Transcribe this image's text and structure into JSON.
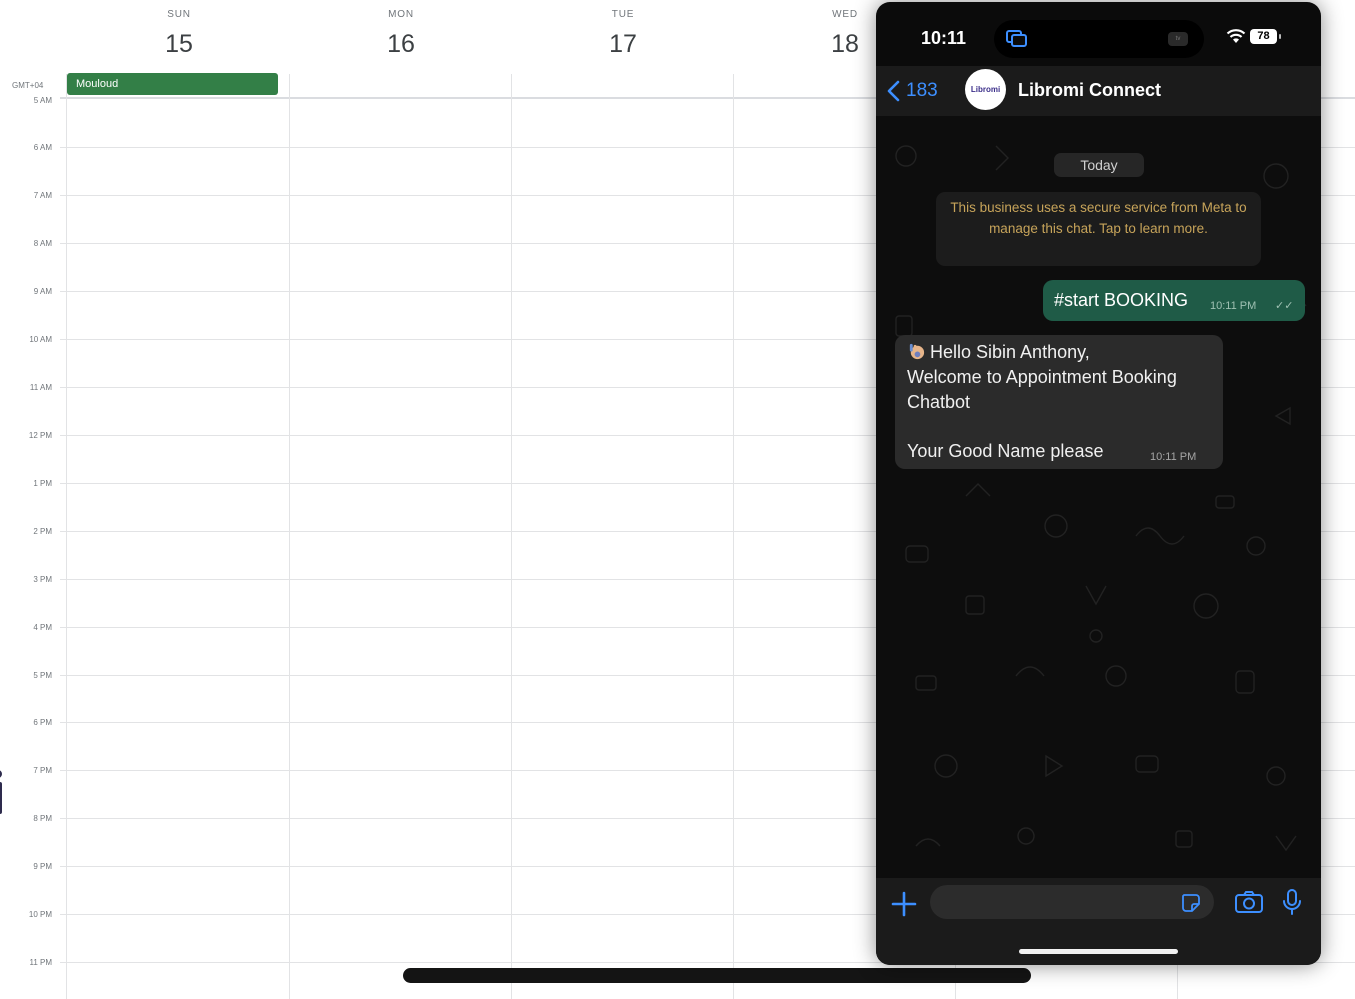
{
  "calendar": {
    "days": [
      {
        "name": "SUN",
        "num": "15"
      },
      {
        "name": "MON",
        "num": "16"
      },
      {
        "name": "TUE",
        "num": "17"
      },
      {
        "name": "WED",
        "num": "18"
      }
    ],
    "timezone": "GMT+04",
    "hours": [
      "5 AM",
      "6 AM",
      "7 AM",
      "8 AM",
      "9 AM",
      "10 AM",
      "11 AM",
      "12 PM",
      "1 PM",
      "2 PM",
      "3 PM",
      "4 PM",
      "5 PM",
      "6 PM",
      "7 PM",
      "8 PM",
      "9 PM",
      "10 PM",
      "11 PM"
    ],
    "event": {
      "title": "Mouloud",
      "color": "#337f47"
    }
  },
  "phone": {
    "status": {
      "time": "10:11",
      "battery": "78",
      "island_badge": "tv"
    },
    "header": {
      "back_count": "183",
      "title": "Libromi Connect",
      "avatar_text": "Libromi"
    },
    "chat": {
      "date_pill": "Today",
      "notice": "This business uses a secure service from Meta to manage this chat. Tap to learn more.",
      "outgoing": {
        "text": "#start BOOKING",
        "time": "10:11 PM",
        "ticks": "✓✓"
      },
      "incoming": {
        "line1": "Hello Sibin Anthony,",
        "line2": "Welcome to Appointment Booking",
        "line3": "Chatbot",
        "line4": "Your Good Name please",
        "time": "10:11 PM"
      }
    },
    "colors": {
      "accent": "#3d8fff",
      "outgoing_bubble": "#1f5b47",
      "incoming_bubble": "#2b2b2b"
    }
  }
}
